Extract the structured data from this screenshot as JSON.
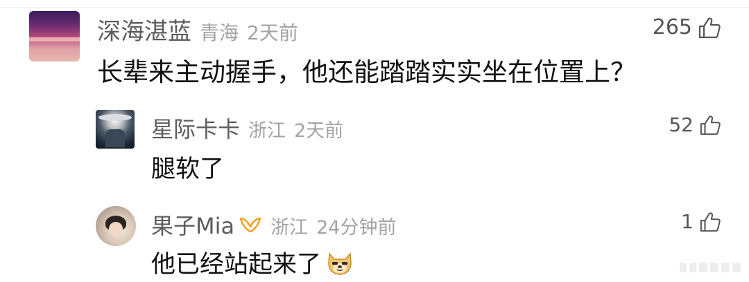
{
  "comments": [
    {
      "author": "深海湛蓝",
      "location": "青海",
      "time": "2天前",
      "likes": "265",
      "text": "长辈来主动握手，他还能踏踏实实坐在位置上？",
      "avatar_icon": "sunset-sea-avatar"
    },
    {
      "author": "星际卡卡",
      "location": "浙江",
      "time": "2天前",
      "likes": "52",
      "text": "腿软了",
      "avatar_icon": "swordsman-avatar"
    },
    {
      "author": "果子Mia",
      "badge_icon": "gold-ribbon-badge-icon",
      "location": "浙江",
      "time": "24分钟前",
      "likes": "1",
      "text": "他已经站起来了",
      "emoji_icon": "doge-emoji-icon",
      "avatar_icon": "child-photo-avatar"
    }
  ],
  "like_icon": "thumbs-up-icon",
  "colors": {
    "author": "#5c5c5c",
    "meta": "#a3a3a3",
    "text": "#111111",
    "badge": "#f0a226"
  }
}
